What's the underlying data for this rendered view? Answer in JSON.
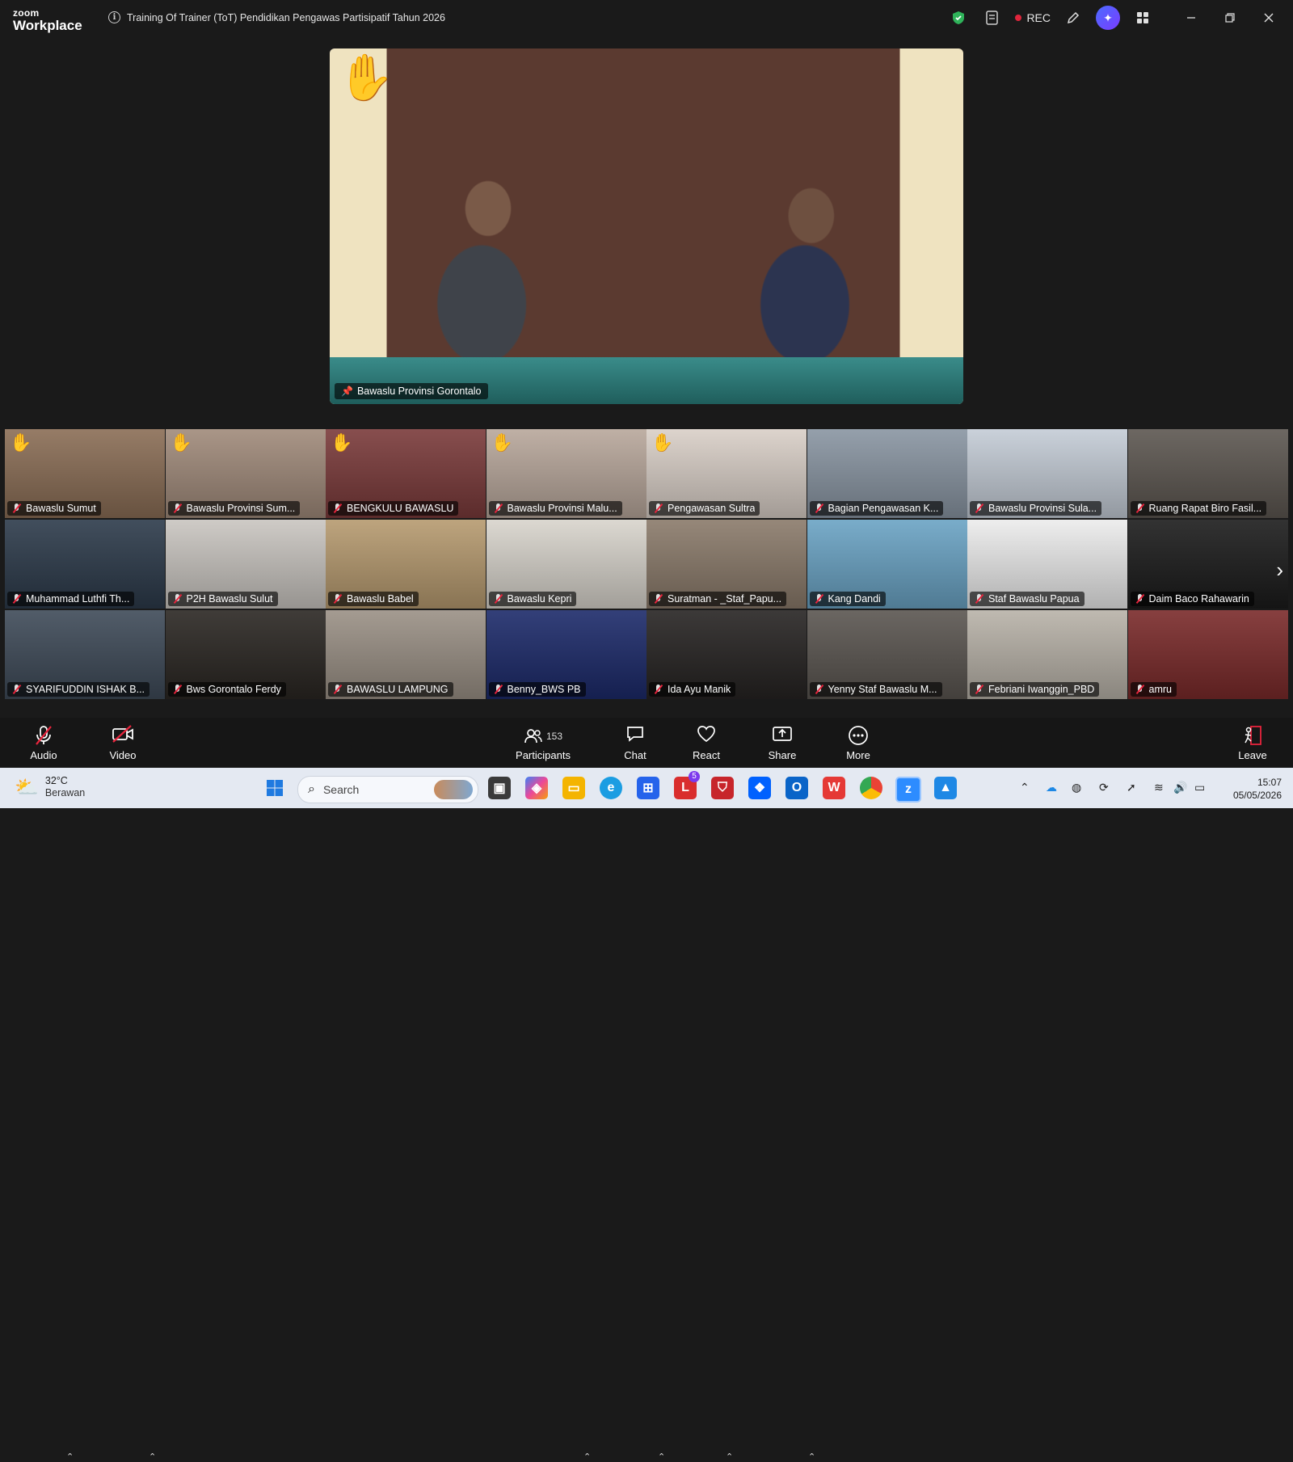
{
  "app": {
    "brand_top": "zoom",
    "brand_bottom": "Workplace",
    "meeting_title": "Training Of Trainer (ToT) Pendidikan Pengawas Partisipatif Tahun 2026",
    "rec_label": "REC"
  },
  "speaker": {
    "name": "Bawaslu Provinsi Gorontalo"
  },
  "participants": [
    {
      "name": "Bawaslu Sumut",
      "hand": true,
      "bg": "#8a6d55"
    },
    {
      "name": "Bawaslu Provinsi Sum...",
      "hand": true,
      "bg": "#a08a7a"
    },
    {
      "name": "BENGKULU BAWASLU",
      "hand": true,
      "bg": "#7a3a3a"
    },
    {
      "name": "Bawaslu Provinsi Malu...",
      "hand": true,
      "bg": "#b8a79b"
    },
    {
      "name": "Pengawasan Sultra",
      "hand": true,
      "bg": "#d9cfc7"
    },
    {
      "name": "Bagian Pengawasan K...",
      "hand": false,
      "bg": "#8995a2"
    },
    {
      "name": "Bawaslu Provinsi Sula...",
      "hand": false,
      "bg": "#c4ccd6"
    },
    {
      "name": "Ruang Rapat Biro Fasil...",
      "hand": false,
      "bg": "#5c5650"
    },
    {
      "name": "Muhammad Luthfi Th...",
      "hand": false,
      "bg": "#2c3a4a"
    },
    {
      "name": "P2H Bawaslu Sulut",
      "hand": false,
      "bg": "#c9c5c0"
    },
    {
      "name": "Bawaslu Babel",
      "hand": false,
      "bg": "#b69a6f"
    },
    {
      "name": "Bawaslu Kepri",
      "hand": false,
      "bg": "#d8d4cc"
    },
    {
      "name": "Suratman - _Staf_Papu...",
      "hand": false,
      "bg": "#8a7a6a"
    },
    {
      "name": "Kang Dandi",
      "hand": false,
      "bg": "#6aa3c4"
    },
    {
      "name": "Staf Bawaslu Papua",
      "hand": false,
      "bg": "#ececec"
    },
    {
      "name": "Daim Baco Rahawarin",
      "hand": false,
      "bg": "#1b1b1b"
    },
    {
      "name": "SYARIFUDDIN ISHAK B...",
      "hand": false,
      "bg": "#3e4a58"
    },
    {
      "name": "Bws Gorontalo Ferdy",
      "hand": false,
      "bg": "#2a2622"
    },
    {
      "name": "BAWASLU LAMPUNG",
      "hand": false,
      "bg": "#9a9085"
    },
    {
      "name": "Benny_BWS PB",
      "hand": false,
      "bg": "#1c2a6a"
    },
    {
      "name": "Ida Ayu Manik",
      "hand": false,
      "bg": "#262322"
    },
    {
      "name": "Yenny Staf Bawaslu M...",
      "hand": false,
      "bg": "#5a5550"
    },
    {
      "name": "Febriani Iwanggin_PBD",
      "hand": false,
      "bg": "#b8b2a8"
    },
    {
      "name": "amru",
      "hand": false,
      "bg": "#7a2a2a"
    }
  ],
  "toolbar": {
    "audio": "Audio",
    "video": "Video",
    "participants": "Participants",
    "participants_count": "153",
    "chat": "Chat",
    "react": "React",
    "share": "Share",
    "more": "More",
    "leave": "Leave"
  },
  "taskbar": {
    "temp": "32°C",
    "weather": "Berawan",
    "search_placeholder": "Search",
    "time": "15:07",
    "date": "05/05/2026",
    "badge": "5"
  }
}
